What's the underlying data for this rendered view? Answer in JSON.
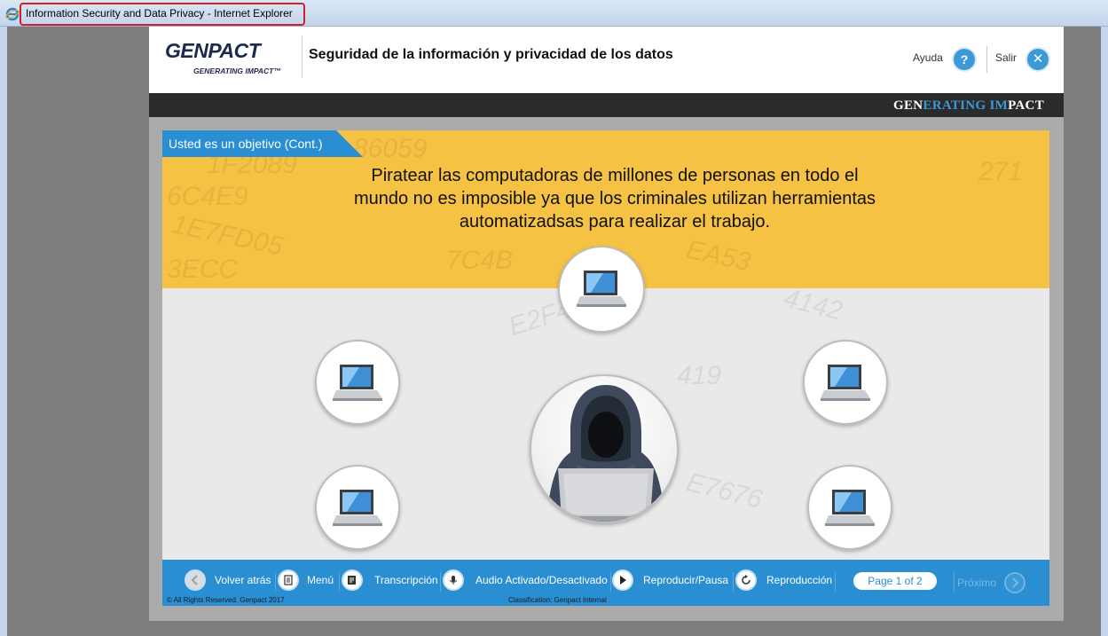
{
  "window": {
    "title": "Information Security and Data Privacy - Internet Explorer"
  },
  "header": {
    "logo_main": "GENPACT",
    "logo_sub": "GENERATING IMPACT™",
    "course_title": "Seguridad de la información y privacidad de los datos",
    "help_label": "Ayuda",
    "help_icon_text": "?",
    "exit_label": "Salir",
    "exit_icon_text": "✕"
  },
  "stripe": {
    "brand_part1": "GEN",
    "brand_part2": "ERATING ",
    "brand_part3": "IM",
    "brand_part4": "PACT"
  },
  "slide": {
    "tab_title": "Usted es un objetivo (Cont.)",
    "heading_line1": "Piratear las computadoras de millones de personas en todo el",
    "heading_line2": "mundo no es imposible ya que los criminales utilizan herramientas",
    "heading_line3": "automatizadsas para realizar el trabajo.",
    "background_codes": [
      "86059",
      "1F2089",
      "6C4E9",
      "1E7FD05",
      "3ECC",
      "7C4B",
      "EA53",
      "E2F4",
      "4142",
      "419",
      "E7676",
      "271"
    ]
  },
  "navbar": {
    "back_label": "Volver atrás",
    "menu_label": "Menú",
    "transcript_label": "Transcripción",
    "audio_label": "Audio Activado/Desactivado",
    "playpause_label": "Reproducir/Pausa",
    "replay_label": "Reproducción",
    "page_indicator": "Page 1 of 2",
    "next_label": "Próximo",
    "copyright": "© All Rights Reserved. Genpact 2017",
    "classification": "Classification: Genpact Internal"
  },
  "colors": {
    "accent_blue": "#2a8ed3",
    "banner_yellow": "#f6c244",
    "dark_stripe": "#2b2b2b"
  }
}
